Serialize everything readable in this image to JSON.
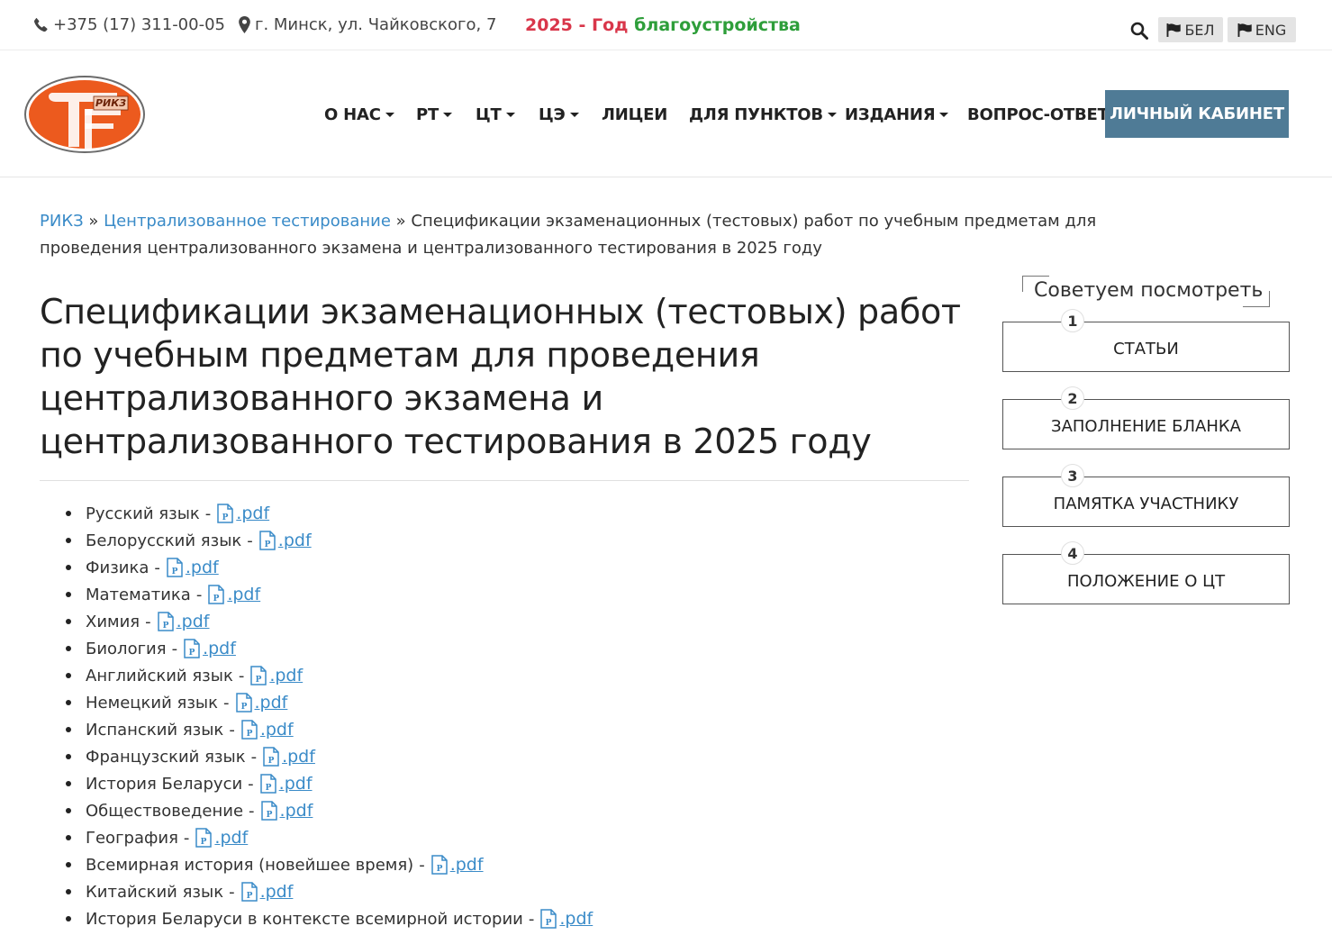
{
  "topbar": {
    "phone": "+375 (17) 311-00-05",
    "address": "г. Минск, ул. Чайковского, 7",
    "year_red": "2025 - Год",
    "year_green": "благоустройства",
    "lang_bel": "БЕЛ",
    "lang_eng": "ENG"
  },
  "logo": {
    "text": "РИКЗ"
  },
  "nav": {
    "about": "О НАС",
    "rt": "РТ",
    "ct": "ЦТ",
    "ce": "ЦЭ",
    "lyceums": "ЛИЦЕИ",
    "points": "ДЛЯ ПУНКТОВ",
    "publications": "ИЗДАНИЯ",
    "faq": "ВОПРОС-ОТВЕТ",
    "cabinet": "ЛИЧНЫЙ КАБИНЕТ"
  },
  "breadcrumb": {
    "home": "РИКЗ",
    "sep": "»",
    "section": "Централизованное тестирование",
    "current": "Спецификации экзаменационных (тестовых) работ по учебным предметам для проведения централизованного экзамена и централизованного тестирования в 2025 году"
  },
  "page_title": "Спецификации экзаменационных (тестовых) работ по учебным предметам для проведения централизованного экзамена и централизованного тестирования в 2025 году",
  "specs": {
    "dash": "-",
    "link_label": ".pdf",
    "items": [
      "Русский язык",
      "Белорусский язык",
      "Физика",
      "Математика",
      "Химия",
      "Биология",
      "Английский язык",
      "Немецкий язык",
      "Испанский язык",
      "Французский язык",
      "История Беларуси",
      "Обществоведение",
      "География",
      "Всемирная история (новейшее время)",
      "Китайский язык",
      "История Беларуси в контексте всемирной истории"
    ]
  },
  "sidebar": {
    "title": "Советуем посмотреть",
    "items": [
      {
        "num": "1",
        "label": "СТАТЬИ"
      },
      {
        "num": "2",
        "label": "ЗАПОЛНЕНИЕ БЛАНКА"
      },
      {
        "num": "3",
        "label": "ПАМЯТКА УЧАСТНИКУ"
      },
      {
        "num": "4",
        "label": "ПОЛОЖЕНИЕ О ЦТ"
      }
    ]
  },
  "colors": {
    "link": "#3a8bc8",
    "year_red": "#d9364a",
    "year_green": "#2e9e3a",
    "cabinet_bg": "#4f7b96",
    "logo_orange": "#ec5a1e"
  }
}
